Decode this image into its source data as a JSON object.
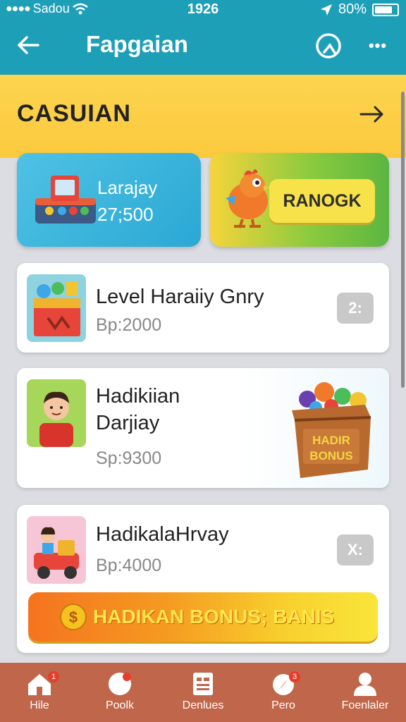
{
  "status_bar": {
    "signal_dots": "●●●●",
    "carrier": "Sadou",
    "time": "1926",
    "battery": "80%",
    "battery_level": 0.8
  },
  "app_bar": {
    "title": "Fapgaian"
  },
  "category": {
    "title": "CASUIAN"
  },
  "tiles": {
    "left": {
      "label": "Larajay",
      "value": "27;500"
    },
    "right": {
      "button": "RANOGK"
    }
  },
  "cards": [
    {
      "title": "Level Haraiiy Gnry",
      "subtitle": "Bp:2000",
      "action_icon": "2:"
    },
    {
      "title_line1": "Hadikiian",
      "title_line2": "Darjiay",
      "subtitle": "Sp:9300",
      "crate_line1": "HADIR",
      "crate_line2": "BONUS"
    },
    {
      "title": "HadikalaHrvay",
      "subtitle": "Bp:4000",
      "action_icon": "X:",
      "banner": "HADIKAN BONUS; BANIS",
      "banner_coin": "$"
    }
  ],
  "bottom_nav": [
    {
      "label": "Hile",
      "icon": "home-icon",
      "badge": "1"
    },
    {
      "label": "Poolk",
      "icon": "chat-bubble-icon"
    },
    {
      "label": "Denlues",
      "icon": "menu-grid-icon"
    },
    {
      "label": "Pero",
      "icon": "compass-icon",
      "badge": "3"
    },
    {
      "label": "Foenlaler",
      "icon": "person-icon"
    }
  ],
  "colors": {
    "app_bar": "#1e9fb8",
    "category": "#fbc93d",
    "bottom_nav": "#c0664a",
    "accent_orange": "#f5731f"
  }
}
